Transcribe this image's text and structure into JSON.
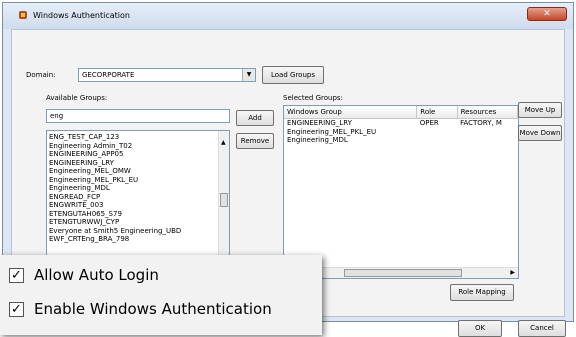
{
  "window": {
    "title": "Windows Authentication",
    "close_glyph": "✕"
  },
  "domain": {
    "label": "Domain:",
    "value": "GECORPORATE",
    "load_groups": "Load Groups"
  },
  "available": {
    "label": "Available Groups:",
    "filter_value": "eng",
    "items": [
      "ENG_TEST_CAP_123",
      "Engineering Admin_T02",
      "ENGINEERING_APP05",
      "ENGINEERING_LRY",
      "Engineering_MEL_OMW",
      "Engineering_MEL_PKL_EU",
      "Engineering_MDL",
      "ENGREAD_FCP",
      "ENGWRITE_003",
      "ETENGUTAH065_S79",
      "ETENGTURWWJ_CYP",
      "Everyone at Smith5 Engineering_UBD",
      "EWF_CRTEng_BRA_798"
    ]
  },
  "buttons": {
    "add": "Add",
    "remove": "Remove",
    "move_up": "Move Up",
    "move_down": "Move Down",
    "role_mapping": "Role Mapping",
    "ok": "OK",
    "cancel": "Cancel"
  },
  "selected": {
    "label": "Selected Groups:",
    "columns": [
      "Windows Group",
      "Role",
      "Resources"
    ],
    "rows": [
      [
        "ENGINEERING_LRY",
        "OPER",
        "FACTORY, M"
      ],
      [
        "Engineering_MEL_PKL_EU",
        "",
        ""
      ],
      [
        "Engineering_MDL",
        "",
        ""
      ]
    ]
  },
  "options": {
    "allow_auto_login": {
      "label": "Allow Auto Login",
      "checked": true
    },
    "enable_windows_auth": {
      "label": "Enable Windows Authentication",
      "checked": true
    }
  },
  "colors": {
    "accent": "#7f9db9",
    "close": "#c2452d"
  }
}
